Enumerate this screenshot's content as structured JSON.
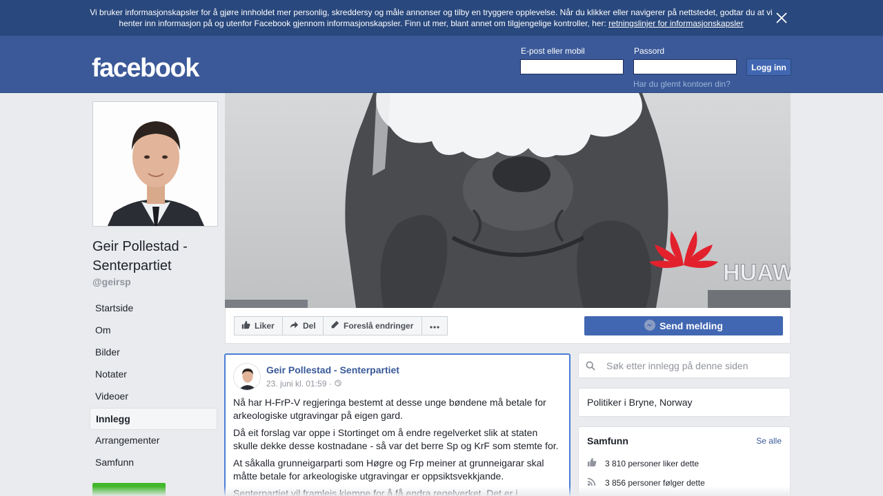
{
  "cookie_banner": {
    "text": "Vi bruker informasjonskapsler for å gjøre innholdet mer personlig, skreddersy og måle annonser og tilby en tryggere opplevelse. Når du klikker eller navigerer på nettstedet, godtar du at vi henter inn informasjon på og utenfor Facebook gjennom informasjonskapsler. Finn ut mer, blant annet om tilgjengelige kontroller, her: ",
    "link": "retningslinjer for informasjonskapsler",
    "close_icon": "close-icon"
  },
  "header": {
    "logo": "facebook",
    "email_label": "E-post eller mobil",
    "password_label": "Passord",
    "email_value": "",
    "password_value": "",
    "login_button": "Logg inn",
    "forgot_link": "Har du glemt kontoen din?"
  },
  "page": {
    "name": "Geir Pollestad - Senterpartiet",
    "handle": "@geirsp"
  },
  "nav": {
    "items": [
      {
        "label": "Startside",
        "active": false
      },
      {
        "label": "Om",
        "active": false
      },
      {
        "label": "Bilder",
        "active": false
      },
      {
        "label": "Notater",
        "active": false
      },
      {
        "label": "Videoer",
        "active": false
      },
      {
        "label": "Innlegg",
        "active": true
      },
      {
        "label": "Arrangementer",
        "active": false
      },
      {
        "label": "Samfunn",
        "active": false
      }
    ]
  },
  "cover": {
    "sign_text": "HUAW"
  },
  "actions": {
    "like": "Liker",
    "share": "Del",
    "suggest": "Foreslå endringer",
    "more_icon": "more-icon",
    "send": "Send melding"
  },
  "post": {
    "author": "Geir Pollestad - Senterpartiet",
    "time": "23. juni kl. 01:59 ·",
    "paragraphs": [
      "Nå har H-FrP-V regjeringa bestemt at desse unge bøndene må betale for arkeologiske utgravingar på eigen gard.",
      "Då eit forslag var oppe i Stortinget om å endre regelverket slik at staten skulle dekke desse kostnadane - så var det berre Sp og KrF som stemte for.",
      "At såkalla grunneigarparti som Høgre og Frp meiner at grunneigarar skal måtte betale for arkeologiske utgravingar er oppsiktsvekkjande.",
      "Senterpartiet vil framleis kjempe for å få endra regelverket. Det er i"
    ]
  },
  "sidebar_right": {
    "search_placeholder": "Søk etter innlegg på denne siden",
    "category": "Politiker i Bryne, Norway",
    "community_title": "Samfunn",
    "see_all": "Se alle",
    "likes": "3 810 personer liker dette",
    "follows": "3 856 personer følger dette"
  },
  "colors": {
    "brand": "#3b5998",
    "banner": "#29487d",
    "button": "#4267b2",
    "link": "#385898",
    "green": "#42b72a"
  }
}
